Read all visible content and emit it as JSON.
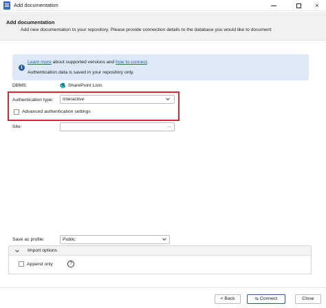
{
  "window": {
    "title": "Add documentation",
    "controls": {
      "minimize": "minimize",
      "maximize": "maximize",
      "close": "×"
    }
  },
  "header": {
    "title": "Add documentation",
    "description": "Add new documentation to your repository. Please provide connection details to the database you would like to document"
  },
  "info": {
    "learn_more": "Learn more",
    "text_mid": " about supported versions and ",
    "how_to_connect": "how to connect",
    "text_end": ".",
    "line2": "Authentication data is saved in your repository only."
  },
  "form": {
    "dbms_label": "DBMS:",
    "dbms_value": "SharePoint Lists",
    "auth_type_label": "Authentication type:",
    "auth_type_value": "Interactive",
    "advanced_auth_label": "Advanced authentication settings",
    "advanced_auth_checked": false,
    "site_label": "Site:",
    "site_value": "",
    "site_browse": "...",
    "save_as_profile_label": "Save as profile:",
    "save_as_profile_value": "Public"
  },
  "import_options": {
    "title": "Import options",
    "append_only_label": "Append only",
    "append_only_checked": false,
    "help": "?"
  },
  "footer": {
    "back_label": "< Back",
    "connect_label": "Connect",
    "close_label": "Close"
  },
  "colors": {
    "highlight": "#d8262c",
    "info_background": "#dde9f6",
    "link": "#1a5fb4",
    "sharepoint": "#038387"
  }
}
